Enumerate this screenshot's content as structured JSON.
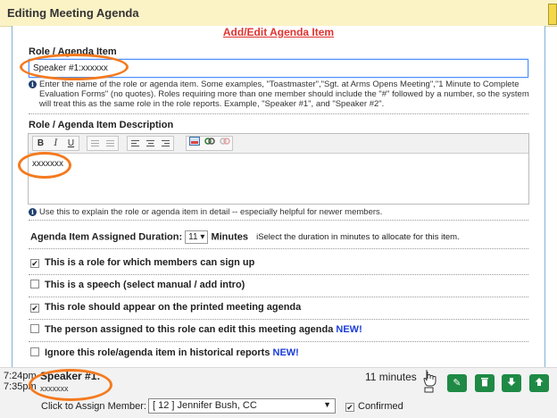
{
  "window": {
    "title": "Editing Meeting Agenda"
  },
  "form": {
    "heading": "Add/Edit Agenda Item",
    "role_label": "Role / Agenda Item",
    "role_value": "Speaker #1:xxxxxx",
    "role_help_lines": [
      "Enter the name of the role or agenda item. Some examples, \"Toastmaster\",\"Sgt. at Arms Opens Meeting\",\"1 Minute to Complete",
      "Evaluation Forms\" (no quotes). Roles requiring more than one member should include the \"#\" followed by a number, so the system",
      "will treat this as the same role in the role reports. Example, \"Speaker #1\", and \"Speaker #2\"."
    ],
    "description_label": "Role / Agenda Item Description",
    "description_value": "xxxxxxx",
    "toolbar": {
      "bold": "B",
      "italic": "I",
      "underline": "U"
    },
    "description_help": "Use this to explain the role or agenda item in detail -- especially helpful for newer members.",
    "duration_label": "Agenda Item Assigned Duration:",
    "duration_value": "11",
    "duration_unit": "Minutes",
    "duration_help": "Select the duration in minutes to allocate for this item.",
    "checkboxes": [
      {
        "label": "This is a role for which members can sign up",
        "checked": true,
        "badge": ""
      },
      {
        "label": "This is a speech (select manual / add intro)",
        "checked": false,
        "badge": ""
      },
      {
        "label": "This role should appear on the printed meeting agenda",
        "checked": true,
        "badge": ""
      },
      {
        "label": "The person assigned to this role can edit this meeting agenda",
        "checked": false,
        "badge": "NEW!"
      },
      {
        "label": "Ignore this role/agenda item in historical reports",
        "checked": false,
        "badge": "NEW!"
      }
    ]
  },
  "agenda_row": {
    "start_time": "7:24pm",
    "end_time": "7:35pm",
    "title": "Speaker #1:",
    "subtitle": "xxxxxxx",
    "duration": "11 minutes",
    "assign_label": "Click to Assign Member:",
    "assign_value": "[ 12 ] Jennifer Bush, CC",
    "confirmed_label": "Confirmed",
    "confirmed": true,
    "buttons": [
      "edit-icon",
      "trash-icon",
      "arrow-down-icon",
      "arrow-up-icon"
    ]
  },
  "colors": {
    "title_bar": "#fbf3c6",
    "heading": "#e0332f",
    "new_badge": "#1a3dd8",
    "action_button": "#1e8a45",
    "highlight": "#f47a1f"
  }
}
